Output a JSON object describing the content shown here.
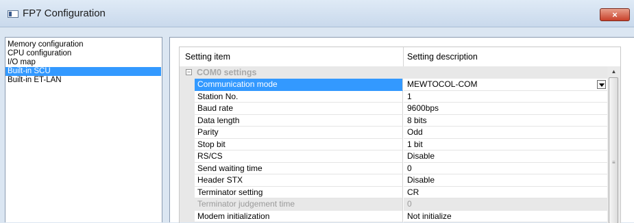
{
  "window": {
    "title": "FP7 Configuration",
    "close_label": "×"
  },
  "sidebar": {
    "items": [
      {
        "label": "Memory configuration",
        "selected": false
      },
      {
        "label": "CPU configuration",
        "selected": false
      },
      {
        "label": "I/O map",
        "selected": false
      },
      {
        "label": "Built-in SCU",
        "selected": true
      },
      {
        "label": "Built-in ET-LAN",
        "selected": false
      }
    ]
  },
  "grid": {
    "headers": {
      "item": "Setting item",
      "description": "Setting description"
    },
    "group": {
      "label": "COM0 settings",
      "toggle": "⊟"
    },
    "rows": [
      {
        "name": "Communication mode",
        "value": "MEWTOCOL-COM",
        "selected": true,
        "disabled": false
      },
      {
        "name": "Station No.",
        "value": "1",
        "selected": false,
        "disabled": false
      },
      {
        "name": "Baud rate",
        "value": "9600bps",
        "selected": false,
        "disabled": false
      },
      {
        "name": "Data length",
        "value": "8 bits",
        "selected": false,
        "disabled": false
      },
      {
        "name": "Parity",
        "value": "Odd",
        "selected": false,
        "disabled": false
      },
      {
        "name": "Stop bit",
        "value": "1 bit",
        "selected": false,
        "disabled": false
      },
      {
        "name": "RS/CS",
        "value": "Disable",
        "selected": false,
        "disabled": false
      },
      {
        "name": "Send waiting time",
        "value": "0",
        "selected": false,
        "disabled": false
      },
      {
        "name": "Header STX",
        "value": "Disable",
        "selected": false,
        "disabled": false
      },
      {
        "name": "Terminator setting",
        "value": "CR",
        "selected": false,
        "disabled": false
      },
      {
        "name": "Terminator judgement time",
        "value": "0",
        "selected": false,
        "disabled": true
      },
      {
        "name": "Modem initialization",
        "value": "Not initialize",
        "selected": false,
        "disabled": false
      }
    ]
  },
  "colors": {
    "selection": "#3399ff",
    "window_bg": "#dbe6f2",
    "close_button": "#c8402a"
  }
}
